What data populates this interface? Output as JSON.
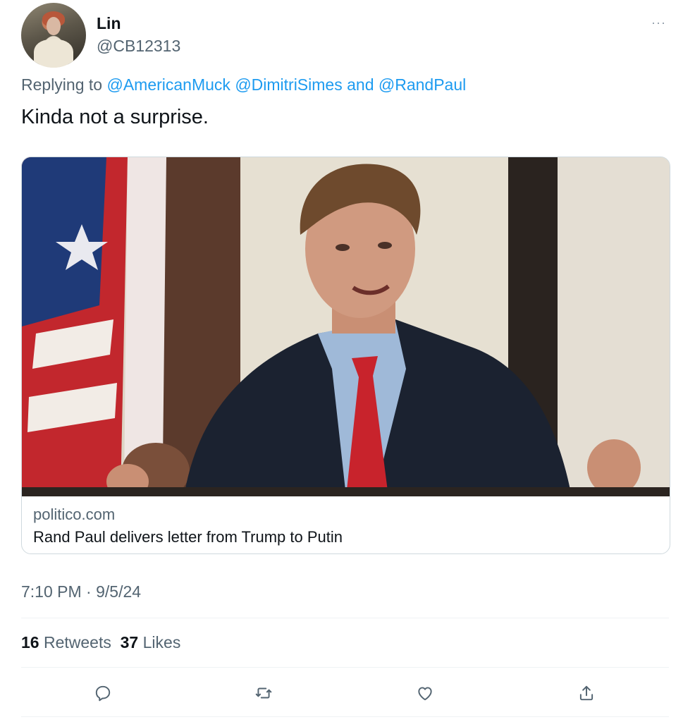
{
  "author": {
    "display_name": "Lin",
    "handle": "@CB12313"
  },
  "more_menu_label": "···",
  "reply_context": {
    "prefix": "Replying to",
    "mentions": [
      "@AmericanMuck",
      "@DimitriSimes"
    ],
    "conjunction": "and",
    "last_mention": "@RandPaul"
  },
  "tweet_text": "Kinda not a surprise.",
  "link_card": {
    "domain": "politico.com",
    "title": "Rand Paul delivers letter from Trump to Putin"
  },
  "timestamp": {
    "time": "7:10 PM",
    "separator": "·",
    "date": "9/5/24"
  },
  "stats": {
    "retweets_count": "16",
    "retweets_label": "Retweets",
    "likes_count": "37",
    "likes_label": "Likes"
  },
  "actions": [
    {
      "name": "reply",
      "icon": "reply-icon"
    },
    {
      "name": "retweet",
      "icon": "retweet-icon"
    },
    {
      "name": "like",
      "icon": "heart-icon"
    },
    {
      "name": "share",
      "icon": "share-icon"
    }
  ],
  "colors": {
    "link": "#1d9bf0",
    "secondary_text": "#536471",
    "primary_text": "#0f1419",
    "border": "#cfd9de"
  }
}
